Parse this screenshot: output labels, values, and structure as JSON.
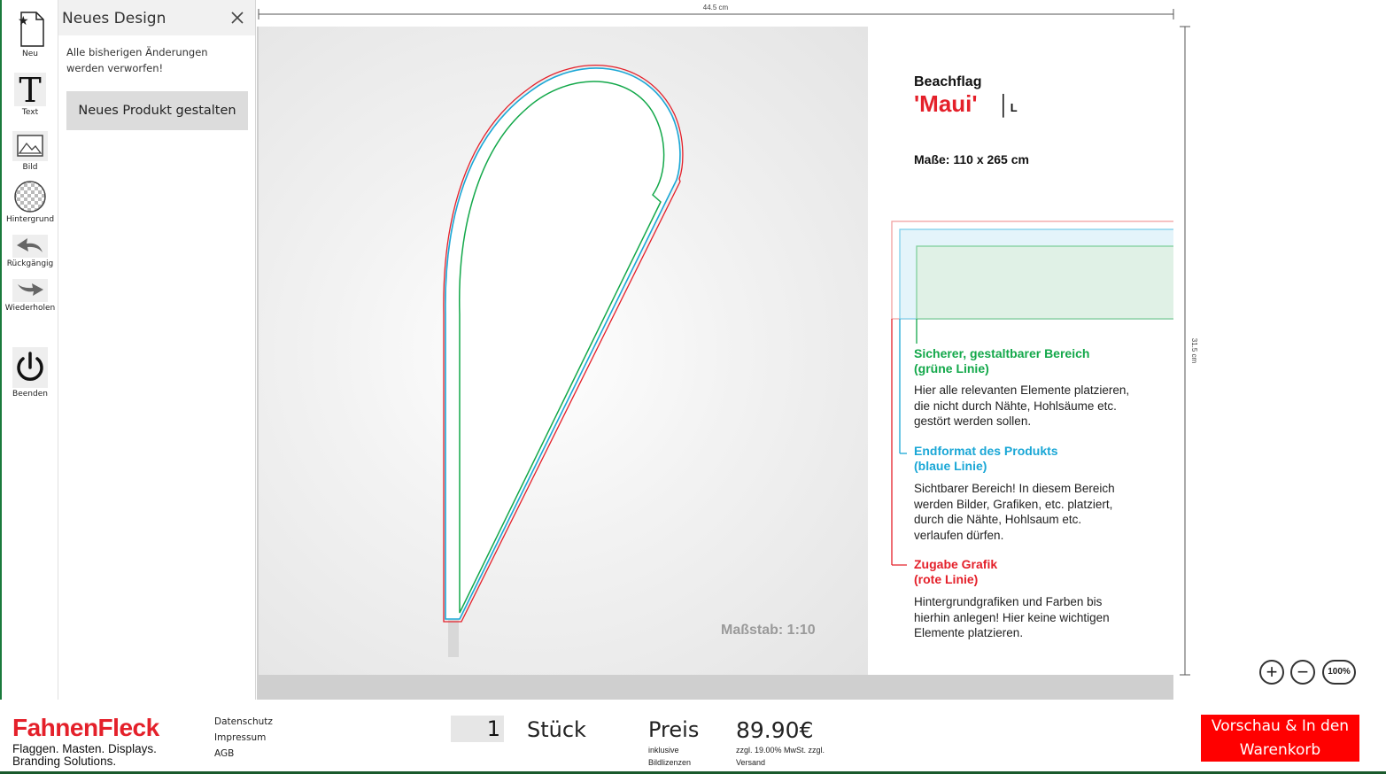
{
  "toolbar": {
    "items": [
      {
        "label": "Neu",
        "icon": "new-document-icon"
      },
      {
        "label": "Text",
        "icon": "text-icon"
      },
      {
        "label": "Bild",
        "icon": "image-icon"
      },
      {
        "label": "Hintergrund",
        "icon": "background-icon"
      },
      {
        "label": "Rückgängig",
        "icon": "undo-icon"
      },
      {
        "label": "Wiederholen",
        "icon": "redo-icon"
      },
      {
        "label": "Beenden",
        "icon": "power-icon"
      }
    ]
  },
  "panel": {
    "title": "Neues Design",
    "message": "Alle bisherigen Änderungen werden verworfen!",
    "button": "Neues Produkt gestalten"
  },
  "rulers": {
    "width": "44.5 cm",
    "height": "31.5 cm"
  },
  "info": {
    "product_type": "Beachflag",
    "product_name": "'Maui'",
    "size_code": "L",
    "dimensions": "Maße: 110 x 265 cm",
    "legend": [
      {
        "heading1": "Sicherer, gestaltbarer Bereich",
        "heading2": "(grüne Linie)",
        "color": "#13a84a",
        "lines": [
          "Hier alle relevanten Elemente platzieren,",
          "die nicht durch Nähte, Hohlsäume etc.",
          "gestört werden sollen."
        ]
      },
      {
        "heading1": "Endformat des Produkts",
        "heading2": "(blaue Linie)",
        "color": "#1aa7d6",
        "lines": [
          "Sichtbarer Bereich! In diesem Bereich",
          "werden Bilder, Grafiken, etc. platziert,",
          "durch die Nähte, Hohlsaum etc.",
          "verlaufen dürfen."
        ]
      },
      {
        "heading1": "Zugabe Grafik",
        "heading2": "(rote Linie)",
        "color": "#e4202a",
        "lines": [
          "Hintergrundgrafiken und Farben bis",
          "hierhin anlegen! Hier keine wichtigen",
          "Elemente platzieren."
        ]
      }
    ]
  },
  "canvas": {
    "scale": "Maßstab: 1:10"
  },
  "zoom": {
    "in": "+",
    "out": "−",
    "reset": "100%"
  },
  "footer": {
    "logo": "FahnenFleck",
    "tagline1": "Flaggen. Masten. Displays.",
    "tagline2": "Branding Solutions.",
    "links": [
      "Datenschutz",
      "Impressum",
      "AGB"
    ],
    "quantity": "1",
    "quantity_unit": "Stück",
    "price_label": "Preis",
    "price_note1": "inklusive",
    "price_note2": "Bildlizenzen",
    "price_value": "89.90€",
    "vat_note1": "zzgl. 19.00% MwSt. zzgl.",
    "vat_note2": "Versand",
    "cart_button_line1": "Vorschau & In den",
    "cart_button_line2": "Warenkorb"
  },
  "colors": {
    "brand_red": "#e4202a",
    "safe_green": "#13a84a",
    "final_blue": "#1aa7d6",
    "bleed_red": "#e4202a"
  }
}
